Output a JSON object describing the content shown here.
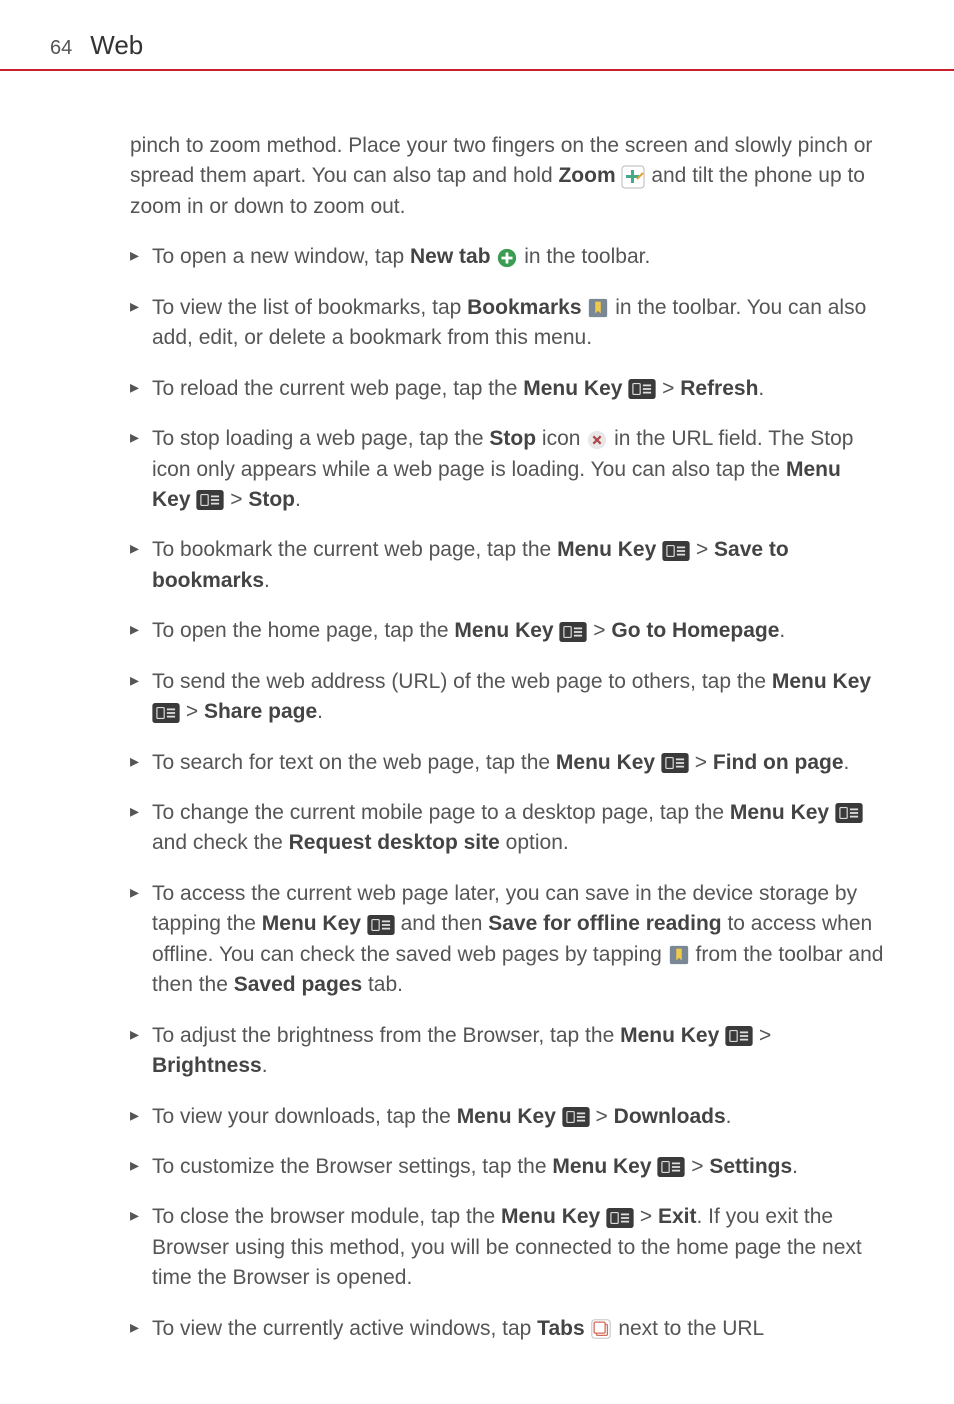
{
  "header": {
    "page_number": "64",
    "title": "Web"
  },
  "intro": {
    "t1": "pinch to zoom method. Place your two fingers on the screen and slowly pinch or spread them apart. You can also tap and hold ",
    "zoom_label": "Zoom",
    "t2": " and tilt the phone up to zoom in or down to zoom out."
  },
  "items": [
    {
      "pre": "To open a new window, tap ",
      "b1": "New tab",
      "icon1": "plus-circle",
      "post": " in the toolbar."
    },
    {
      "pre": "To view the list of bookmarks, tap ",
      "b1": "Bookmarks",
      "icon1": "bookmark",
      "post": " in the toolbar. You can also add, edit, or delete a bookmark from this menu."
    },
    {
      "pre": "To reload the current web page, tap the ",
      "b1": "Menu Key",
      "icon1": "menu-key",
      "mid": " > ",
      "b2": "Refresh",
      "post": "."
    },
    {
      "pre": "To stop loading a web page, tap the ",
      "b1": "Stop",
      "post1": " icon ",
      "icon1": "stop-circle",
      "post2": " in the URL field. The Stop icon only appears while a web page is loading. You can also tap the ",
      "b2": "Menu Key",
      "icon2": "menu-key",
      "mid2": " > ",
      "b3": "Stop",
      "post": "."
    },
    {
      "pre": "To bookmark the current web page, tap the ",
      "b1": "Menu Key",
      "icon1": "menu-key",
      "mid": " > ",
      "b2": "Save to bookmarks",
      "post": "."
    },
    {
      "pre": "To open the home page, tap the ",
      "b1": "Menu Key",
      "icon1": "menu-key",
      "mid": " > ",
      "b2": "Go to Homepage",
      "post": "."
    },
    {
      "pre": "To send the web address (URL) of the web page to others, tap the ",
      "b1": "Menu Key",
      "icon1": "menu-key",
      "mid": " > ",
      "b2": "Share page",
      "post": "."
    },
    {
      "pre": "To search for text on the web page, tap the ",
      "b1": "Menu Key",
      "icon1": "menu-key",
      "mid": " > ",
      "b2": "Find on page",
      "post": "."
    },
    {
      "pre": "To change the current mobile page to a desktop page, tap the ",
      "b1": "Menu Key",
      "icon1": "menu-key",
      "mid": " and check the ",
      "b2": "Request desktop site",
      "post": " option."
    },
    {
      "pre": "To access the current web page later, you can save in the device storage by tapping the ",
      "b1": "Menu Key",
      "icon1": "menu-key",
      "mid": " and then ",
      "b2": "Save for offline reading",
      "post2": " to access when offline. You can check the saved web pages by tapping ",
      "icon2": "bookmark",
      "post3": " from the toolbar and then the ",
      "b3": "Saved pages",
      "post": " tab."
    },
    {
      "pre": "To adjust the brightness from the Browser, tap the ",
      "b1": "Menu Key",
      "icon1": "menu-key",
      "mid": " > ",
      "b2": "Brightness",
      "post": "."
    },
    {
      "pre": "To view your downloads, tap the ",
      "b1": "Menu Key",
      "icon1": "menu-key",
      "mid": " > ",
      "b2": "Downloads",
      "post": "."
    },
    {
      "pre": "To customize the Browser settings, tap the ",
      "b1": "Menu Key",
      "icon1": "menu-key",
      "mid": " > ",
      "b2": "Settings",
      "post": "."
    },
    {
      "pre": "To close the browser module, tap the ",
      "b1": "Menu Key",
      "icon1": "menu-key",
      "mid": " > ",
      "b2": "Exit",
      "post": ". If you exit the Browser using this method, you will be connected to the home page the next time the Browser is opened."
    },
    {
      "pre": "To view the currently active windows, tap ",
      "b1": "Tabs",
      "icon1": "tabs",
      "post": " next to the URL"
    }
  ]
}
